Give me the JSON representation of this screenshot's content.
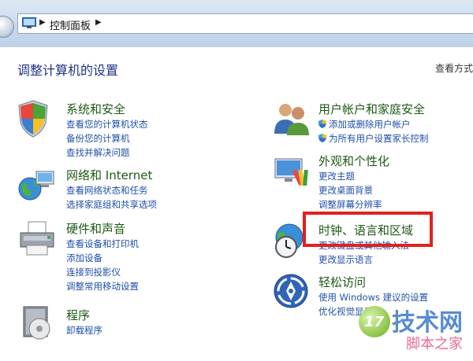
{
  "address_bar": {
    "path": "控制面板"
  },
  "page": {
    "title": "调整计算机的设置",
    "view_by": "查看方式："
  },
  "categories": {
    "system_security": {
      "title": "系统和安全",
      "links": [
        "查看您的计算机状态",
        "备份您的计算机",
        "查找并解决问题"
      ]
    },
    "network": {
      "title": "网络和 Internet",
      "links": [
        "查看网络状态和任务",
        "选择家庭组和共享选项"
      ]
    },
    "hardware_sound": {
      "title": "硬件和声音",
      "links": [
        "查看设备和打印机",
        "添加设备",
        "连接到投影仪",
        "调整常用移动设置"
      ]
    },
    "programs": {
      "title": "程序",
      "links": [
        "卸载程序"
      ]
    },
    "user_accounts": {
      "title": "用户帐户和家庭安全",
      "links": [
        "添加或删除用户帐户",
        "为所有用户设置家长控制"
      ]
    },
    "appearance": {
      "title": "外观和个性化",
      "links": [
        "更改主题",
        "更改桌面背景",
        "调整屏幕分辨率"
      ]
    },
    "clock_region": {
      "title": "时钟、语言和区域",
      "links": [
        "更改键盘或其他输入法",
        "更改显示语言"
      ]
    },
    "ease_of_access": {
      "title": "轻松访问",
      "links": [
        "使用 Windows 建议的设置",
        "优化视觉显示"
      ]
    }
  },
  "watermark": {
    "number": "17",
    "big": "技术网",
    "small": "脚本之家"
  },
  "colors": {
    "category_title": "#1e5a14",
    "link": "#1f4fa8",
    "page_title": "#1e3287",
    "highlight": "#e2211c"
  }
}
